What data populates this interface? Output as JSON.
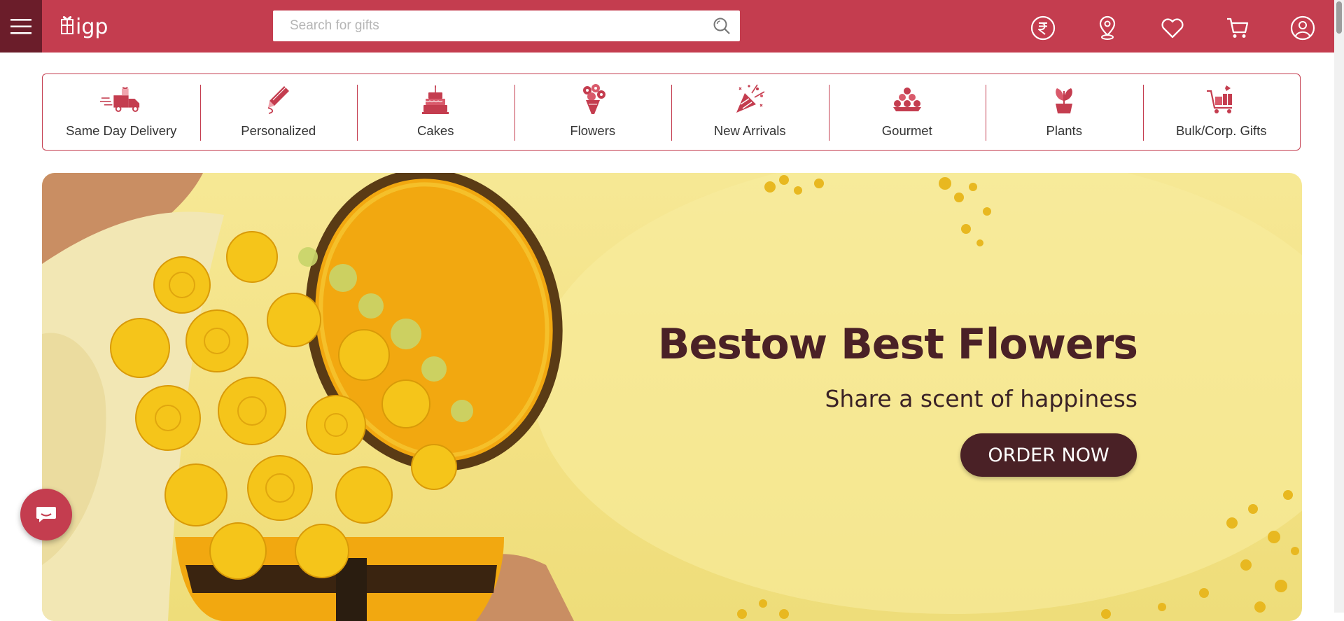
{
  "header": {
    "logo_text": "igp",
    "search_placeholder": "Search for gifts",
    "icons": [
      "menu-icon",
      "search-icon",
      "rupee-currency-icon",
      "location-icon",
      "heart-icon",
      "cart-icon",
      "user-account-icon"
    ]
  },
  "categories": [
    {
      "label": "Same Day Delivery",
      "icon": "delivery-truck-icon"
    },
    {
      "label": "Personalized",
      "icon": "pencil-icon"
    },
    {
      "label": "Cakes",
      "icon": "cake-icon"
    },
    {
      "label": "Flowers",
      "icon": "bouquet-icon"
    },
    {
      "label": "New Arrivals",
      "icon": "party-popper-icon"
    },
    {
      "label": "Gourmet",
      "icon": "sweets-platter-icon"
    },
    {
      "label": "Plants",
      "icon": "potted-plant-icon"
    },
    {
      "label": "Bulk/Corp. Gifts",
      "icon": "gift-cart-icon"
    }
  ],
  "banner": {
    "title": "Bestow Best Flowers",
    "subtitle": "Share a scent of happiness",
    "cta": "ORDER NOW"
  },
  "colors": {
    "brand": "#c43d4f",
    "brand_dark": "#6b1d2a",
    "banner_text": "#4a2126",
    "banner_bg": "#f6e895"
  }
}
